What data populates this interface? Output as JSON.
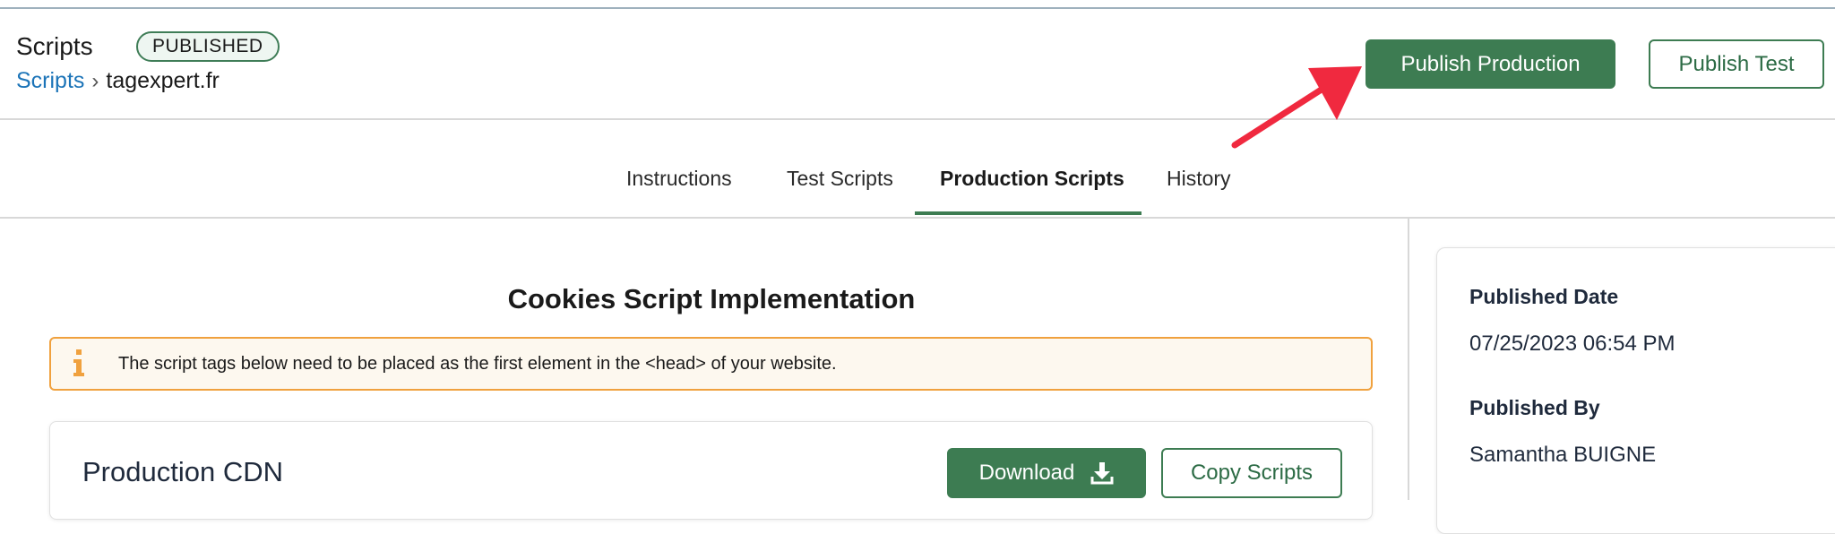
{
  "header": {
    "title": "Scripts",
    "status_badge": "PUBLISHED",
    "breadcrumb": {
      "link": "Scripts",
      "separator": "›",
      "current": "tagexpert.fr"
    },
    "publish_production_label": "Publish Production",
    "publish_test_label": "Publish Test"
  },
  "tabs": [
    {
      "label": "Instructions"
    },
    {
      "label": "Test Scripts"
    },
    {
      "label": "Production Scripts",
      "active": true
    },
    {
      "label": "History"
    }
  ],
  "main": {
    "section_title": "Cookies Script Implementation",
    "info_message": "The script tags below need to be placed as the first element in the <head> of your website.",
    "card": {
      "title": "Production CDN",
      "download_label": "Download",
      "copy_label": "Copy Scripts"
    }
  },
  "side_panel": {
    "published_date_label": "Published Date",
    "published_date_value": "07/25/2023 06:54 PM",
    "published_by_label": "Published By",
    "published_by_value": "Samantha BUIGNE"
  },
  "icons": {
    "info": "info-icon",
    "download": "download-icon",
    "annotation": "red-arrow-annotation"
  },
  "colors": {
    "accent_green": "#3d7c52",
    "link_blue": "#1c74b8",
    "warning_orange": "#f0a13e",
    "annotation_red": "#f0293f"
  }
}
